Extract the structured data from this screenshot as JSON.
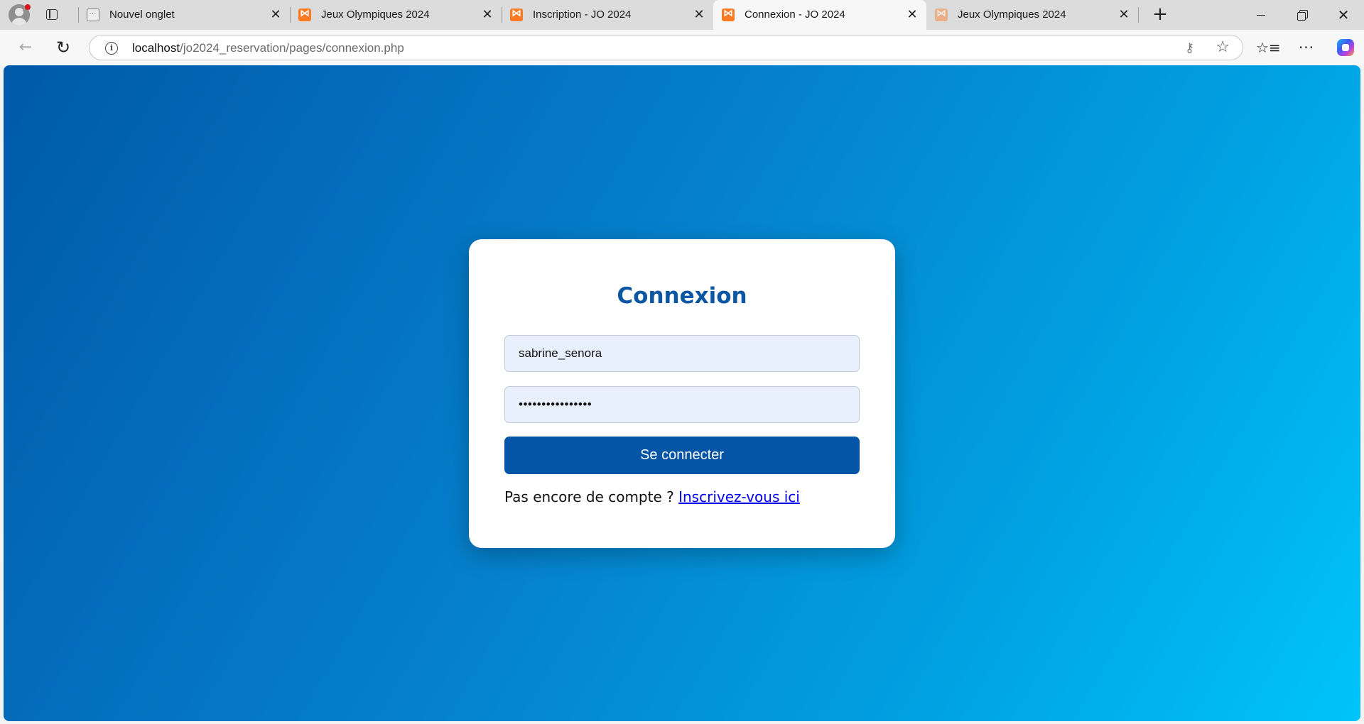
{
  "browser": {
    "tabs": [
      {
        "title": "Nouvel onglet",
        "icon": "new-tab-page-icon",
        "active": false
      },
      {
        "title": "Jeux Olympiques 2024",
        "icon": "xampp-icon",
        "active": false
      },
      {
        "title": "Inscription - JO 2024",
        "icon": "xampp-icon",
        "active": false
      },
      {
        "title": "Connexion - JO 2024",
        "icon": "xampp-icon",
        "active": true
      },
      {
        "title": "Jeux Olympiques 2024",
        "icon": "xampp-icon",
        "active": false
      }
    ],
    "address": {
      "host": "localhost",
      "path": "/jo2024_reservation/pages/connexion.php"
    }
  },
  "login": {
    "title": "Connexion",
    "username_value": "sabrine_senora",
    "password_mask": "••••••••••••••••",
    "submit_label": "Se connecter",
    "signup_prompt": "Pas encore de compte ?",
    "signup_link": "Inscrivez-vous ici"
  },
  "colors": {
    "accent": "#0555a6",
    "title": "#0b57a4",
    "gradient_start": "#0059aa",
    "gradient_end": "#00c4fb",
    "link": "#0000ee",
    "input_bg": "#e8f0fe"
  }
}
